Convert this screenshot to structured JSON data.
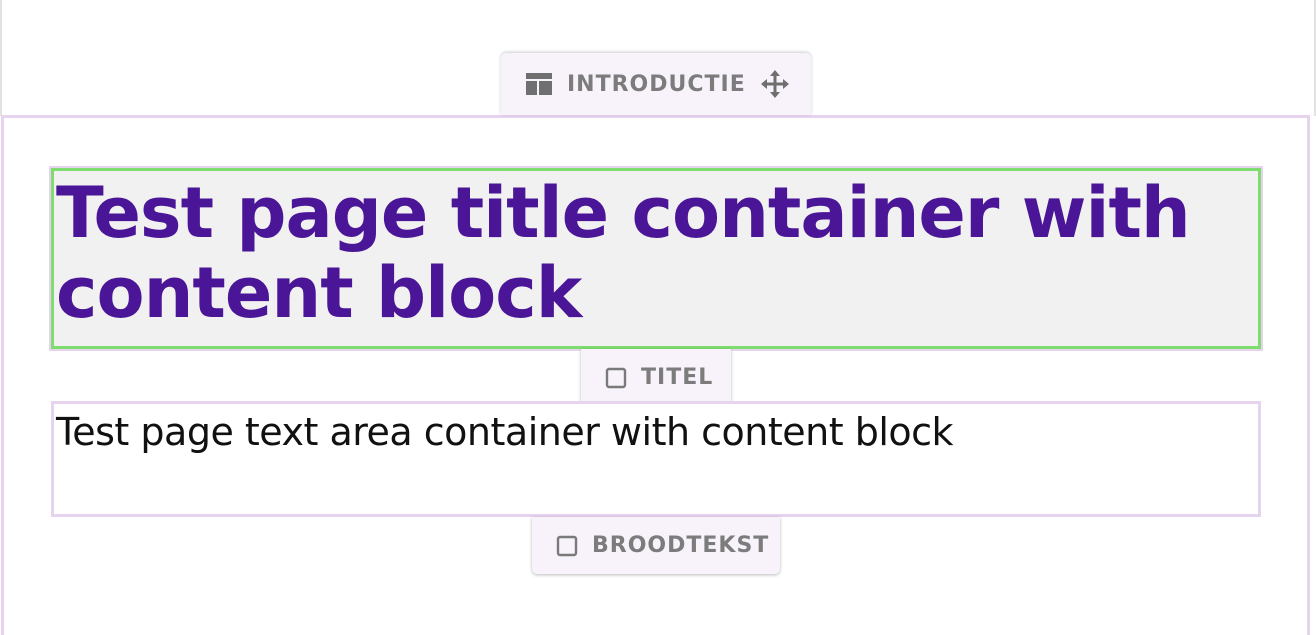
{
  "section": {
    "tab_label": "INTRODUCTIE",
    "icons": {
      "layout": "layout-icon",
      "move": "move-icon"
    }
  },
  "title_block": {
    "text": "Test page title container with content block",
    "tab_label": "TITEL",
    "icon": "checkbox-icon",
    "text_color": "#4a1596",
    "border_color": "#7fdc6f"
  },
  "text_block": {
    "text": "Test page text area container with content block",
    "tab_label": "BROODTEKST",
    "icon": "checkbox-icon"
  },
  "colors": {
    "accent_border": "#e6d3ee",
    "tab_background": "#f8f2fb",
    "tab_text": "#7c7c7c"
  }
}
